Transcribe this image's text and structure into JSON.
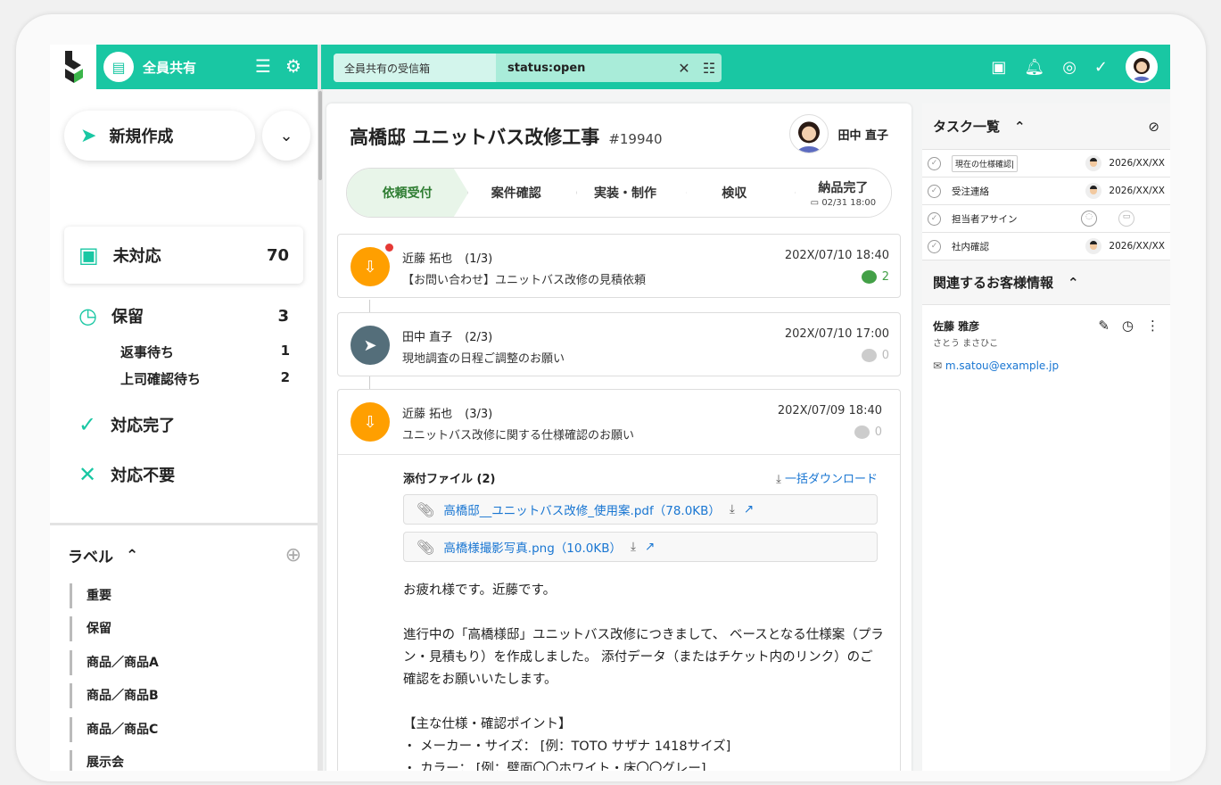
{
  "topbar": {
    "workspace": "全員共有",
    "search_scope": "全員共有の受信箱",
    "search_query": "status:open"
  },
  "sidebar": {
    "new_label": "新規作成",
    "nav": [
      {
        "label": "未対応",
        "count": "70"
      },
      {
        "label": "保留",
        "count": "3"
      },
      {
        "label": "対応完了",
        "count": ""
      },
      {
        "label": "対応不要",
        "count": ""
      }
    ],
    "sub": [
      {
        "label": "返事待ち",
        "count": "1"
      },
      {
        "label": "上司確認待ち",
        "count": "2"
      }
    ],
    "labels_title": "ラベル",
    "labels": [
      "重要",
      "保留",
      "商品／商品A",
      "商品／商品B",
      "商品／商品C",
      "展示会"
    ]
  },
  "ticket": {
    "title": "高橋邸 ユニットバス改修工事",
    "number": "#19940",
    "assignee": "田中 直子",
    "steps": [
      {
        "label": "依頼受付"
      },
      {
        "label": "案件確認"
      },
      {
        "label": "実装・制作"
      },
      {
        "label": "検収"
      },
      {
        "label": "納品完了",
        "date": "02/31 18:00"
      }
    ],
    "messages": [
      {
        "from": "近藤 拓也",
        "seq": "(1/3)",
        "subject": "【お問い合わせ】ユニットバス改修の見積依頼",
        "time": "202X/07/10 18:40",
        "comments": "2"
      },
      {
        "from": "田中 直子",
        "seq": "(2/3)",
        "subject": "現地調査の日程ご調整のお願い",
        "time": "202X/07/10 17:00",
        "comments": "0"
      },
      {
        "from": "近藤 拓也",
        "seq": "(3/3)",
        "subject": "ユニットバス改修に関する仕様確認のお願い",
        "time": "202X/07/09 18:40",
        "comments": "0"
      }
    ],
    "attachments_title": "添付ファイル (2)",
    "download_all": "一括ダウンロード",
    "files": [
      "高橋邸__ユニットバス改修_使用案.pdf（78.0KB）",
      "高橋様撮影写真.png（10.0KB）"
    ],
    "body": [
      "お疲れ様です。近藤です。",
      "進行中の「高橋様邸」ユニットバス改修につきまして、 ベースとなる仕様案（プラン・見積もり）を作成しました。 添付データ（またはチケット内のリンク）のご確認をお願いいたします。",
      "【主な仕様・確認ポイント】",
      "・ メーカー・サイズ： [例：TOTO サザナ 1418サイズ]",
      "・ カラー： [例：壁面〇〇ホワイト・床〇〇グレー]"
    ]
  },
  "tasks": {
    "title": "タスク一覧",
    "items": [
      {
        "name": "現在の仕様確認|",
        "date": "2026/XX/XX"
      },
      {
        "name": "受注連絡",
        "date": "2026/XX/XX"
      },
      {
        "name": "担当者アサイン",
        "date": ""
      },
      {
        "name": "社内確認",
        "date": "2026/XX/XX"
      }
    ]
  },
  "customer": {
    "title": "関連するお客様情報",
    "name": "佐藤 雅彦",
    "kana": "さとう まさひこ",
    "email": "m.satou@example.jp"
  },
  "colors": {
    "brand": "#19c7a3",
    "link": "#1976d2",
    "orange": "#ff9f00",
    "slate": "#546e7a"
  }
}
